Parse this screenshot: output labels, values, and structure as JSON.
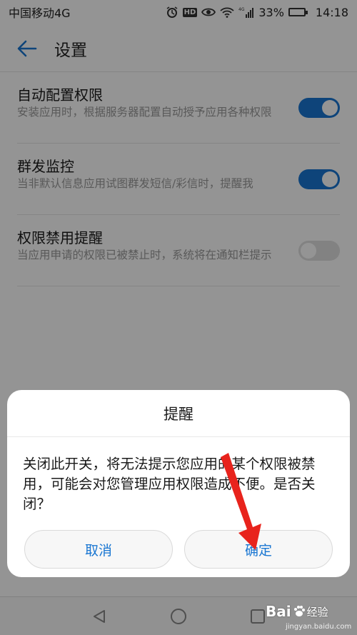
{
  "status_bar": {
    "carrier": "中国移动4G",
    "network_badge": "4G",
    "battery_percent": "33%",
    "battery_level": 0.33,
    "time": "14:18",
    "icons": [
      "alarm-icon",
      "hd-icon",
      "eye-icon",
      "wifi-icon",
      "signal-icon",
      "battery-icon"
    ],
    "hd_label": "HD"
  },
  "app_bar": {
    "back_icon": "arrow-left-icon",
    "title": "设置"
  },
  "settings": [
    {
      "title": "自动配置权限",
      "description": "安装应用时，根据服务器配置自动授予应用各种权限",
      "enabled": true
    },
    {
      "title": "群发监控",
      "description": "当非默认信息应用试图群发短信/彩信时，提醒我",
      "enabled": true
    },
    {
      "title": "权限禁用提醒",
      "description": "当应用申请的权限已被禁止时，系统将在通知栏提示",
      "enabled": false
    }
  ],
  "dialog": {
    "title": "提醒",
    "message": "关闭此开关，将无法提示您应用的某个权限被禁用，可能会对您管理应用权限造成不便。是否关闭？",
    "cancel_label": "取消",
    "confirm_label": "确定"
  },
  "nav_bar": {
    "icons": [
      "nav-back-icon",
      "nav-home-icon",
      "nav-recents-icon"
    ]
  },
  "watermark": {
    "logo": "Bai",
    "logo_suffix": "经验",
    "url": "jingyan.baidu.com"
  },
  "colors": {
    "accent": "#1976d2",
    "annotation_arrow": "#e8231c"
  }
}
